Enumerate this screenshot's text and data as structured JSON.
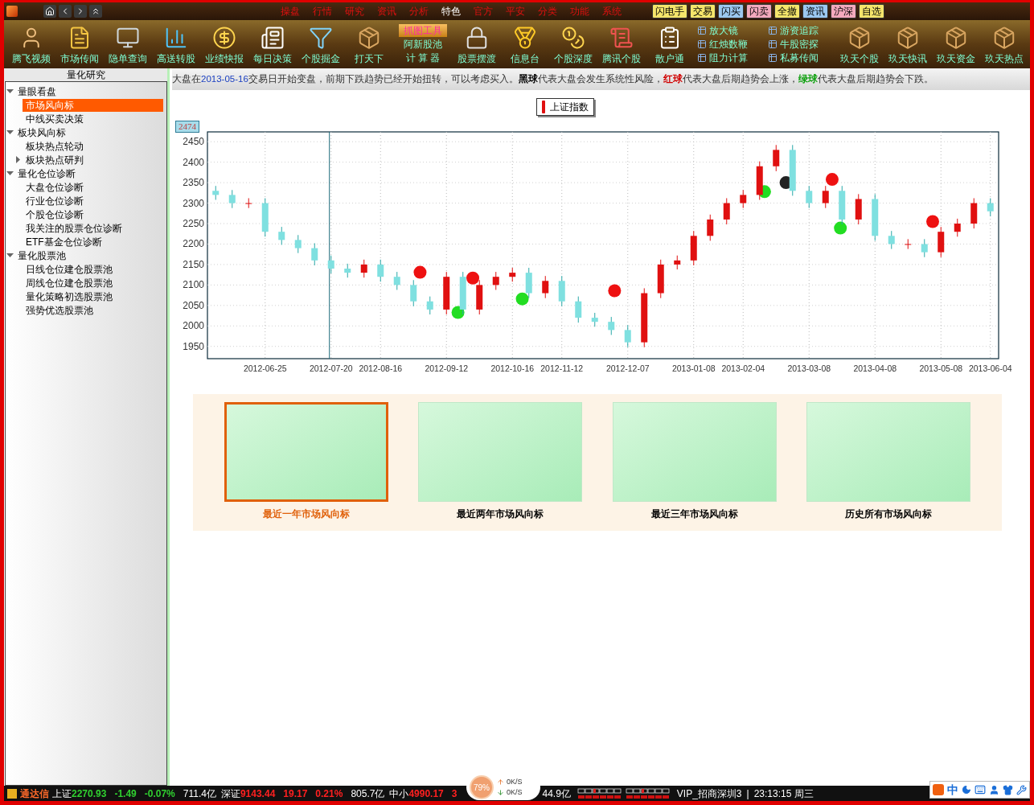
{
  "menu": [
    {
      "label": "操盘",
      "selected": false
    },
    {
      "label": "行情",
      "selected": false
    },
    {
      "label": "研究",
      "selected": false
    },
    {
      "label": "资讯",
      "selected": false
    },
    {
      "label": "分析",
      "selected": false
    },
    {
      "label": "特色",
      "selected": true
    },
    {
      "label": "官方",
      "selected": false
    },
    {
      "label": "平安",
      "selected": false
    },
    {
      "label": "分类",
      "selected": false
    },
    {
      "label": "功能",
      "selected": false
    },
    {
      "label": "系统",
      "selected": false
    }
  ],
  "quick_buttons": [
    {
      "label": "闪电手",
      "color": "#f5e56b"
    },
    {
      "label": "交易",
      "color": "#f5e56b"
    },
    {
      "label": "闪买",
      "color": "#9cc8f0"
    },
    {
      "label": "闪卖",
      "color": "#f3a9bd"
    },
    {
      "label": "全撤",
      "color": "#f5e56b"
    },
    {
      "label": "资讯",
      "color": "#9cc8f0"
    },
    {
      "label": "沪深",
      "color": "#f3a9bd"
    },
    {
      "label": "自选",
      "color": "#f5e56b"
    }
  ],
  "toolbar": [
    {
      "kind": "tool",
      "label": "腾飞视频"
    },
    {
      "kind": "tool",
      "label": "市场传闻"
    },
    {
      "kind": "tool",
      "label": "隐单查询"
    },
    {
      "kind": "tool",
      "label": "高送转股"
    },
    {
      "kind": "tool",
      "label": "业绩快报"
    },
    {
      "kind": "tool",
      "label": "每日决策"
    },
    {
      "kind": "tool",
      "label": "个股掘金"
    },
    {
      "kind": "tool",
      "label": "打天下"
    },
    {
      "kind": "stack",
      "items": [
        {
          "label": "抓图工具",
          "highlighted": true
        },
        {
          "label": "阿新股池",
          "highlighted": false
        },
        {
          "label": "计 算 器",
          "highlighted": false
        }
      ]
    },
    {
      "kind": "tool",
      "label": "股票摆渡"
    },
    {
      "kind": "tool",
      "label": "信息台"
    },
    {
      "kind": "tool",
      "label": "个股深度"
    },
    {
      "kind": "tool",
      "label": "腾讯个股"
    },
    {
      "kind": "tool",
      "label": "散户通"
    },
    {
      "kind": "minilist",
      "items": [
        "放大镜",
        "红烛数鞭",
        "阻力计算"
      ]
    },
    {
      "kind": "minilist",
      "items": [
        "游资追踪",
        "牛股密探",
        "私募传闻"
      ]
    },
    {
      "kind": "tool",
      "label": "玖天个股"
    },
    {
      "kind": "tool",
      "label": "玖天快讯"
    },
    {
      "kind": "tool",
      "label": "玖天资金"
    },
    {
      "kind": "tool",
      "label": "玖天热点"
    }
  ],
  "sidebar": {
    "title": "量化研究",
    "tree": [
      {
        "kind": "folder",
        "label": "量眼看盘",
        "expanded": true,
        "selected": false,
        "children": [
          {
            "kind": "leaf",
            "label": "市场风向标",
            "selected": true
          },
          {
            "kind": "leaf",
            "label": "中线买卖决策",
            "selected": false
          }
        ]
      },
      {
        "kind": "folder",
        "label": "板块风向标",
        "expanded": true,
        "selected": false,
        "children": [
          {
            "kind": "leaf",
            "label": "板块热点轮动",
            "selected": false
          },
          {
            "kind": "folder",
            "label": "板块热点研判",
            "expanded": false,
            "selected": false
          }
        ]
      },
      {
        "kind": "folder",
        "label": "量化仓位诊断",
        "expanded": true,
        "selected": false,
        "children": [
          {
            "kind": "leaf",
            "label": "大盘仓位诊断",
            "selected": false
          },
          {
            "kind": "leaf",
            "label": "行业仓位诊断",
            "selected": false
          },
          {
            "kind": "leaf",
            "label": "个股仓位诊断",
            "selected": false
          },
          {
            "kind": "leaf",
            "label": "我关注的股票仓位诊断",
            "selected": false
          },
          {
            "kind": "leaf",
            "label": "ETF基金仓位诊断",
            "selected": false
          }
        ]
      },
      {
        "kind": "folder",
        "label": "量化股票池",
        "expanded": true,
        "selected": false,
        "children": [
          {
            "kind": "leaf",
            "label": "日线仓位建仓股票池",
            "selected": false
          },
          {
            "kind": "leaf",
            "label": "周线仓位建仓股票池",
            "selected": false
          },
          {
            "kind": "leaf",
            "label": "量化策略初选股票池",
            "selected": false
          },
          {
            "kind": "leaf",
            "label": "强势优选股票池",
            "selected": false
          }
        ]
      }
    ]
  },
  "notice": [
    {
      "kind": "plain",
      "text": "大盘在"
    },
    {
      "kind": "date",
      "text": "2013-05-16"
    },
    {
      "kind": "plain",
      "text": "交易日开始变盘，前期下跌趋势已经开始扭转，可以考虑买入。"
    },
    {
      "kind": "black",
      "text": "黑球"
    },
    {
      "kind": "plain",
      "text": "代表大盘会发生系统性风险，"
    },
    {
      "kind": "red",
      "text": "红球"
    },
    {
      "kind": "plain",
      "text": "代表大盘后期趋势会上涨，"
    },
    {
      "kind": "green",
      "text": "绿球"
    },
    {
      "kind": "plain",
      "text": "代表大盘后期趋势会下跌。"
    }
  ],
  "chart": {
    "chart_data": {
      "type": "candlestick",
      "categories": [
        null,
        null,
        null,
        "2012-06-25",
        null,
        null,
        null,
        "2012-07-20",
        null,
        null,
        "2012-08-16",
        null,
        null,
        null,
        "2012-09-12",
        null,
        null,
        null,
        "2012-10-16",
        null,
        null,
        "2012-11-12",
        null,
        null,
        null,
        "2012-12-07",
        null,
        null,
        null,
        "2013-01-08",
        null,
        null,
        "2013-02-04",
        null,
        null,
        null,
        "2013-03-08",
        null,
        null,
        null,
        "2013-04-08",
        null,
        null,
        null,
        "2013-05-08",
        null,
        null,
        "2013-06-04"
      ],
      "grid": true,
      "ohlc": [
        [
          2330,
          2342,
          2308,
          2320
        ],
        [
          2320,
          2332,
          2288,
          2300
        ],
        [
          2300,
          2312,
          2288,
          2300
        ],
        [
          2300,
          2312,
          2218,
          2230
        ],
        [
          2230,
          2242,
          2198,
          2210
        ],
        [
          2210,
          2222,
          2178,
          2190
        ],
        [
          2190,
          2202,
          2148,
          2160
        ],
        [
          2160,
          2172,
          2128,
          2140
        ],
        [
          2140,
          2152,
          2118,
          2130
        ],
        [
          2130,
          2162,
          2118,
          2150
        ],
        [
          2150,
          2162,
          2108,
          2120
        ],
        [
          2120,
          2132,
          2088,
          2100
        ],
        [
          2100,
          2112,
          2048,
          2060
        ],
        [
          2060,
          2072,
          2028,
          2040
        ],
        [
          2040,
          2132,
          2028,
          2120
        ],
        [
          2120,
          2132,
          2028,
          2040
        ],
        [
          2040,
          2112,
          2028,
          2100
        ],
        [
          2100,
          2132,
          2088,
          2120
        ],
        [
          2120,
          2142,
          2108,
          2130
        ],
        [
          2130,
          2142,
          2068,
          2080
        ],
        [
          2080,
          2122,
          2068,
          2110
        ],
        [
          2110,
          2122,
          2048,
          2060
        ],
        [
          2060,
          2072,
          2008,
          2020
        ],
        [
          2020,
          2032,
          1998,
          2010
        ],
        [
          2010,
          2022,
          1978,
          1990
        ],
        [
          1990,
          2002,
          1948,
          1960
        ],
        [
          1960,
          2092,
          1948,
          2080
        ],
        [
          2080,
          2162,
          2068,
          2150
        ],
        [
          2150,
          2172,
          2138,
          2160
        ],
        [
          2160,
          2232,
          2148,
          2220
        ],
        [
          2220,
          2272,
          2208,
          2260
        ],
        [
          2260,
          2312,
          2248,
          2300
        ],
        [
          2300,
          2332,
          2288,
          2320
        ],
        [
          2320,
          2402,
          2308,
          2390
        ],
        [
          2390,
          2442,
          2378,
          2430
        ],
        [
          2430,
          2442,
          2318,
          2330
        ],
        [
          2330,
          2342,
          2288,
          2300
        ],
        [
          2300,
          2342,
          2288,
          2330
        ],
        [
          2330,
          2342,
          2248,
          2260
        ],
        [
          2260,
          2322,
          2248,
          2310
        ],
        [
          2310,
          2322,
          2208,
          2220
        ],
        [
          2220,
          2232,
          2188,
          2200
        ],
        [
          2200,
          2212,
          2188,
          2200
        ],
        [
          2200,
          2212,
          2168,
          2180
        ],
        [
          2180,
          2242,
          2168,
          2230
        ],
        [
          2230,
          2262,
          2218,
          2250
        ],
        [
          2250,
          2312,
          2238,
          2300
        ],
        [
          2300,
          2312,
          2268,
          2280
        ]
      ],
      "ylim": [
        1920,
        2474
      ],
      "yticks": [
        1950,
        2000,
        2050,
        2100,
        2150,
        2200,
        2250,
        2300,
        2350,
        2400,
        2450
      ]
    },
    "legend": "上证指数",
    "cursor_label": "2474",
    "signals": [
      {
        "color": "#ee1111"
      },
      {
        "color": "#22dd22"
      },
      {
        "color": "#ee1111"
      },
      {
        "color": "#22dd22"
      },
      {
        "color": "#ee1111"
      },
      {
        "color": "#22dd22"
      },
      {
        "color": "#222222"
      },
      {
        "color": "#ee1111"
      },
      {
        "color": "#22dd22"
      },
      {
        "color": "#ee1111"
      }
    ]
  },
  "thumbnails": [
    {
      "label": "最近一年市场风向标",
      "selected": true
    },
    {
      "label": "最近两年市场风向标",
      "selected": false
    },
    {
      "label": "最近三年市场风向标",
      "selected": false
    },
    {
      "label": "历史所有市场风向标",
      "selected": false
    }
  ],
  "status_bar": {
    "app": "通达信",
    "indices": [
      {
        "name": "上证",
        "value": "2270.93",
        "change": "-1.49",
        "percent": "-0.07%",
        "amount": "711.4亿"
      },
      {
        "name": "深证",
        "value": "9143.44",
        "change": "19.17",
        "percent": "0.21%",
        "amount": "805.7亿"
      },
      {
        "name": "中小",
        "value": "4990.17",
        "change": "3"
      }
    ],
    "amount_tail": "44.9亿",
    "server": "VIP_招商深圳3",
    "separator": "|",
    "time": "23:13:15 周三"
  },
  "speed_bubble": {
    "percent": "79%",
    "upload": "0K/S",
    "download": "0K/S"
  },
  "ime_bar": {
    "mode": "中"
  }
}
